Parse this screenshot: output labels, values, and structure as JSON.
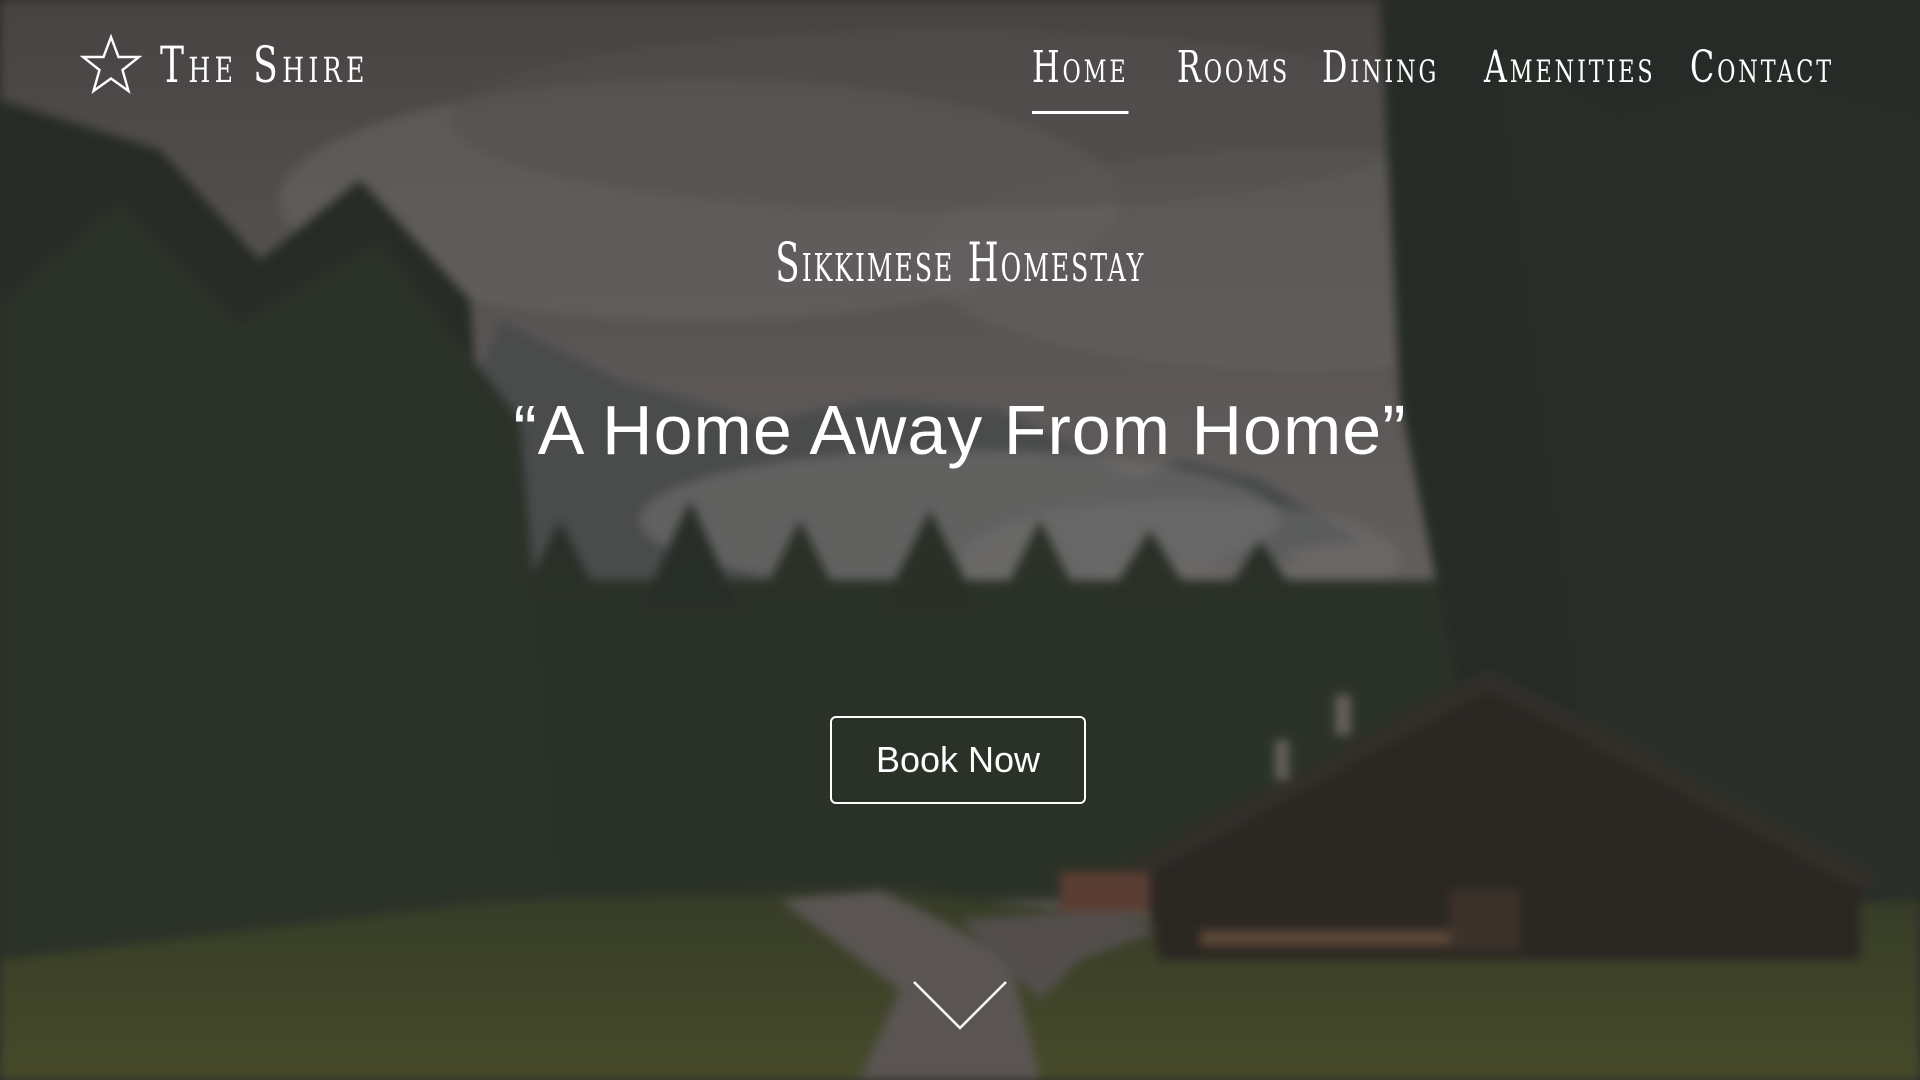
{
  "header": {
    "logo_icon": "star-icon",
    "site_name": "The Shire"
  },
  "nav": {
    "items": [
      {
        "label": "Home",
        "active": true
      },
      {
        "label": "Rooms",
        "active": false
      },
      {
        "label": "Dining",
        "active": false
      },
      {
        "label": "Amenities",
        "active": false
      },
      {
        "label": "Contact",
        "active": false
      }
    ]
  },
  "hero": {
    "subtitle": "Sikkimese Homestay",
    "tagline": "“A Home Away From Home”",
    "cta_label": "Book Now",
    "scroll_icon": "chevron-down-icon"
  },
  "colors": {
    "text": "#ffffff",
    "sky": "#7a7574",
    "forest": "#2a3326",
    "grass": "#4f5a2c",
    "cabin": "#2c2621"
  }
}
